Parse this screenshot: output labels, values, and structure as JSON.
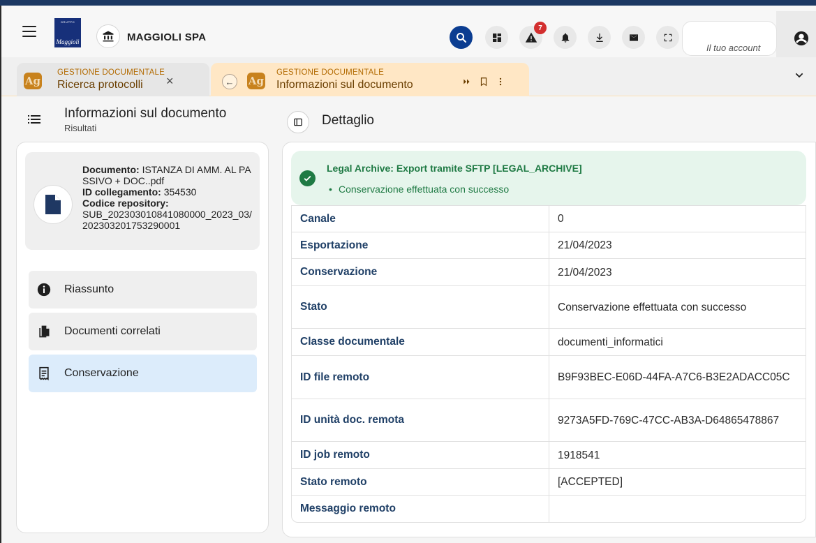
{
  "header": {
    "tenant_name": "MAGGIOLI SPA",
    "logo_top": "GRUPPO",
    "logo_text": "Maggioli",
    "notifications_badge": "7",
    "account_placeholder": "Il tuo account"
  },
  "tabs": [
    {
      "module": "GESTIONE DOCUMENTALE",
      "title": "Ricerca protocolli",
      "icon_text": "Ag"
    },
    {
      "module": "GESTIONE DOCUMENTALE",
      "title": "Informazioni sul documento",
      "icon_text": "Ag"
    }
  ],
  "left": {
    "title": "Informazioni sul documento",
    "subtitle": "Risultati",
    "document": {
      "doc_label": "Documento:",
      "doc_value": "ISTANZA DI AMM. AL PASSIVO + DOC..pdf",
      "link_label": "ID collegamento:",
      "link_value": "354530",
      "repo_label": "Codice repository:",
      "repo_value": "SUB_202303010841080000_2023_03/202303201753290001"
    },
    "nav": [
      {
        "label": "Riassunto",
        "icon": "info-icon"
      },
      {
        "label": "Documenti correlati",
        "icon": "copy-documents-icon"
      },
      {
        "label": "Conservazione",
        "icon": "archive-receipt-icon"
      }
    ]
  },
  "right": {
    "title": "Dettaglio",
    "alert": {
      "title": "Legal Archive: Export tramite SFTP [LEGAL_ARCHIVE]",
      "item": "Conservazione effettuata con successo"
    },
    "rows": [
      {
        "key": "Canale",
        "value": "0"
      },
      {
        "key": "Esportazione",
        "value": "21/04/2023"
      },
      {
        "key": "Conservazione",
        "value": "21/04/2023"
      },
      {
        "key": "Stato",
        "value": "Conservazione effettuata con successo"
      },
      {
        "key": "Classe documentale",
        "value": "documenti_informatici"
      },
      {
        "key": "ID file remoto",
        "value": "B9F93BEC-E06D-44FA-A7C6-B3E2ADACC05C"
      },
      {
        "key": "ID unità doc. remota",
        "value": "9273A5FD-769C-47CC-AB3A-D64865478867"
      },
      {
        "key": "ID job remoto",
        "value": "1918541"
      },
      {
        "key": "Stato remoto",
        "value": "[ACCEPTED]"
      },
      {
        "key": "Messaggio remoto",
        "value": ""
      }
    ]
  },
  "colors": {
    "primary": "#0b3d91",
    "tab_active": "#ffe7c5",
    "module_icon": "#c8821d",
    "success": "#1f7a44",
    "nav_selected": "#dcecfb",
    "label": "#1f3f66"
  }
}
